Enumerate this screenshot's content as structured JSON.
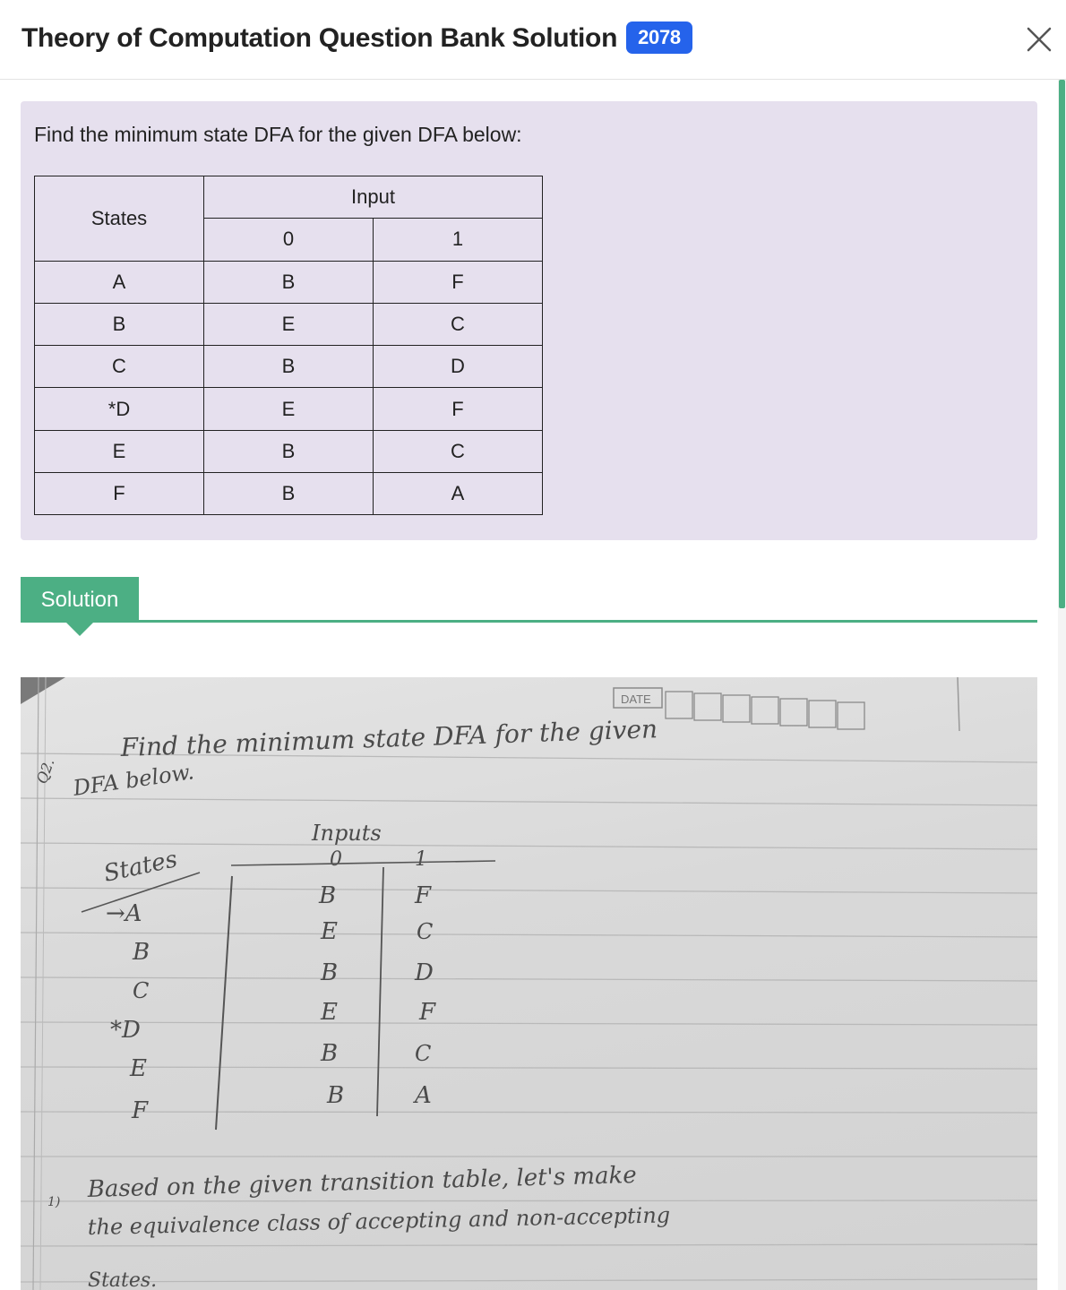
{
  "header": {
    "title": "Theory of Computation Question Bank Solution",
    "year_badge": "2078",
    "close_icon": "close-icon"
  },
  "question": {
    "text": "Find the minimum state DFA for the given DFA below:",
    "table": {
      "states_header": "States",
      "input_header": "Input",
      "symbols": [
        "0",
        "1"
      ],
      "rows": [
        {
          "state": "A",
          "on0": "B",
          "on1": "F"
        },
        {
          "state": "B",
          "on0": "E",
          "on1": "C"
        },
        {
          "state": "C",
          "on0": "B",
          "on1": "D"
        },
        {
          "state": "*D",
          "on0": "E",
          "on1": "F"
        },
        {
          "state": "E",
          "on0": "B",
          "on1": "C"
        },
        {
          "state": "F",
          "on0": "B",
          "on1": "A"
        }
      ]
    }
  },
  "solution": {
    "tab_label": "Solution",
    "accent_color": "#4caf84",
    "image": {
      "date_label": "DATE",
      "line1": "Find the minimum state DFA for the given",
      "line2": "DFA below.",
      "q_marker": "Q2.",
      "inputs_label": "Inputs",
      "symbol0": "0",
      "symbol1": "1",
      "states_label": "States",
      "hw_states": [
        "→A",
        "B",
        "C",
        "*D",
        "E",
        "F"
      ],
      "hw_on0": [
        "B",
        "E",
        "B",
        "E",
        "B",
        "B"
      ],
      "hw_on1": [
        "F",
        "C",
        "D",
        "F",
        "C",
        "A"
      ],
      "step_marker": "1)",
      "para1": "Based on the given transition table, let's make",
      "para2": "the equivalence class of accepting and non-accepting",
      "para3": "States."
    }
  },
  "colors": {
    "badge": "#2563eb",
    "question_bg": "#e6e0ee",
    "accent": "#4caf84"
  }
}
